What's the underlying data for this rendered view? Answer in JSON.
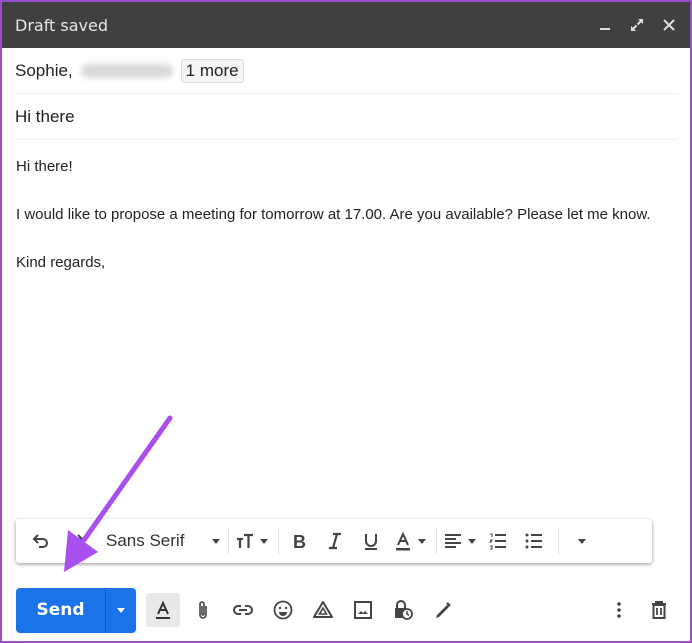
{
  "window": {
    "title": "Draft saved",
    "controls": {
      "minimize_icon": "minimize-icon",
      "fullscreen_icon": "expand-icon",
      "close_icon": "close-icon"
    }
  },
  "recipients": {
    "first": "Sophie,",
    "hidden_recipient": "[blurred address]",
    "more_label": "1 more"
  },
  "subject": "Hi there",
  "body": {
    "paragraphs": [
      "Hi there!",
      "I would like to propose a meeting for tomorrow at 17.00. Are you available? Please let me know.",
      "Kind regards,"
    ]
  },
  "format_toolbar": {
    "undo_icon": "undo-icon",
    "redo_icon": "redo-icon",
    "font_family": "Sans Serif",
    "size_icon": "text-size-icon",
    "bold_icon": "bold-icon",
    "italic_icon": "italic-icon",
    "underline_icon": "underline-icon",
    "text_color_icon": "text-color-icon",
    "align_icon": "align-icon",
    "numbered_list_icon": "numbered-list-icon",
    "bulleted_list_icon": "bulleted-list-icon",
    "more_icon": "more-formatting-icon"
  },
  "bottom_bar": {
    "send_label": "Send",
    "send_options_icon": "dropdown-icon",
    "icons": [
      "formatting-options-icon",
      "attach-icon",
      "link-icon",
      "emoji-icon",
      "drive-icon",
      "photo-icon",
      "confidential-mode-icon",
      "signature-icon"
    ],
    "more_options_icon": "more-vert-icon",
    "discard_icon": "trash-icon"
  },
  "annotation": {
    "arrow_color": "#a94ff0",
    "target": "send-button"
  },
  "colors": {
    "titlebar": "#404040",
    "send_button": "#1a73e8",
    "frame_border": "#9b4dca"
  }
}
